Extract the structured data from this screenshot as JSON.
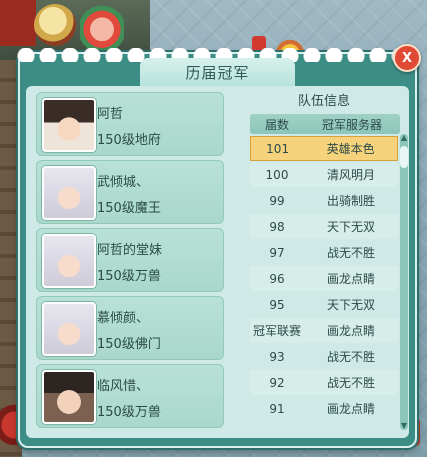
{
  "panel": {
    "title": "历届冠军",
    "close_label": "X"
  },
  "champions": [
    {
      "name": "阿哲",
      "level": "150级地府",
      "avatar": "male-glasses-avatar"
    },
    {
      "name": "武倾城、",
      "level": "150级魔王",
      "avatar": "female-white-hair-avatar"
    },
    {
      "name": "阿哲的堂妹",
      "level": "150级万兽",
      "avatar": "female-white-hair-avatar"
    },
    {
      "name": "慕倾颜、",
      "level": "150级佛门",
      "avatar": "female-white-hair-avatar"
    },
    {
      "name": "临风惜、",
      "level": "150级万兽",
      "avatar": "male-dark-hair-avatar"
    }
  ],
  "team_info": {
    "title": "队伍信息",
    "headers": {
      "session": "届数",
      "server": "冠军服务器"
    },
    "rows": [
      {
        "session": "101",
        "server": "英雄本色",
        "selected": true
      },
      {
        "session": "100",
        "server": "清风明月"
      },
      {
        "session": "99",
        "server": "出骑制胜"
      },
      {
        "session": "98",
        "server": "天下无双"
      },
      {
        "session": "97",
        "server": "战无不胜"
      },
      {
        "session": "96",
        "server": "画龙点睛"
      },
      {
        "session": "95",
        "server": "天下无双"
      },
      {
        "session": "冠军联赛",
        "server": "画龙点睛"
      },
      {
        "session": "93",
        "server": "战无不胜"
      },
      {
        "session": "92",
        "server": "战无不胜"
      },
      {
        "session": "91",
        "server": "画龙点睛"
      }
    ]
  },
  "colors": {
    "panel": "#3c8d86",
    "content": "#cfeae6",
    "selected_row": "#f6d27c",
    "close": "#e04a35"
  }
}
